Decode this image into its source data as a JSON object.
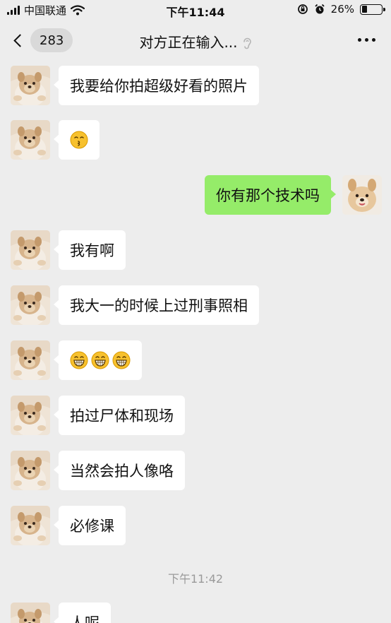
{
  "status_bar": {
    "carrier": "中国联通",
    "time": "下午11:44",
    "battery_percent": "26%",
    "battery_level": 0.26
  },
  "nav": {
    "unread_count": "283",
    "title": "对方正在输入..."
  },
  "messages": [
    {
      "side": "left",
      "text": "我要给你拍超级好看的照片"
    },
    {
      "side": "left",
      "emoji": [
        "kissing-face"
      ]
    },
    {
      "side": "right",
      "text": "你有那个技术吗"
    },
    {
      "side": "left",
      "text": "我有啊"
    },
    {
      "side": "left",
      "text": "我大一的时候上过刑事照相"
    },
    {
      "side": "left",
      "emoji": [
        "grinning-face",
        "grinning-face",
        "grinning-face"
      ]
    },
    {
      "side": "left",
      "text": "拍过尸体和现场"
    },
    {
      "side": "left",
      "text": "当然会拍人像咯"
    },
    {
      "side": "left",
      "text": "必修课"
    },
    {
      "side": "left",
      "text": "人呢"
    }
  ],
  "timestamp": "下午11:42",
  "colors": {
    "background": "#ededed",
    "bubble_self": "#95ec69",
    "bubble_other": "#ffffff"
  }
}
